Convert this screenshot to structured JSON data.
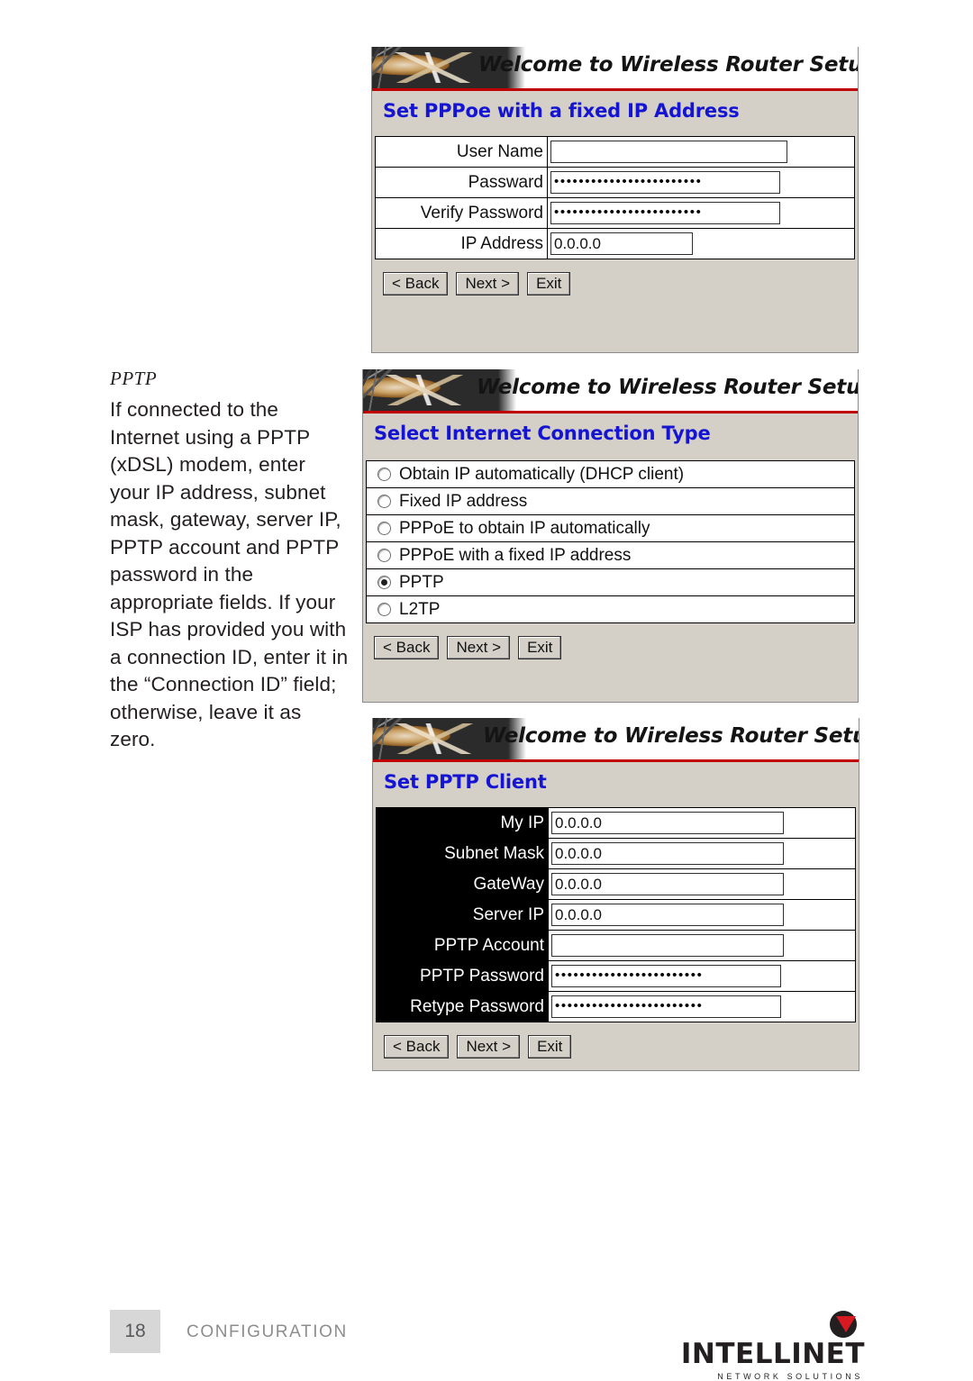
{
  "section": {
    "title": "PPTP",
    "paragraph": "If connected to the Internet using a PPTP (xDSL) modem, enter your IP address, subnet mask, gateway, server IP, PPTP account and PPTP password in the appropriate fields. If your ISP has provided you with a connection ID, enter it in the “Connection ID” field; otherwise, leave it as zero."
  },
  "screens": [
    {
      "banner": "Welcome to Wireless Router Setup Wizard",
      "subhead": "Set PPPoe with a fixed IP Address",
      "fields": [
        {
          "label": "User Name",
          "value": "",
          "type": "text"
        },
        {
          "label": "Passward",
          "value": "••••••••••••••••••••••••",
          "type": "password"
        },
        {
          "label": "Verify Password",
          "value": "••••••••••••••••••••••••",
          "type": "password"
        },
        {
          "label": "IP Address",
          "value": "0.0.0.0",
          "type": "ip"
        }
      ],
      "buttons": [
        "< Back",
        "Next >",
        "Exit"
      ]
    },
    {
      "banner": "Welcome to Wireless Router Setup Wizard",
      "subhead": "Select Internet Connection Type",
      "options": [
        {
          "label": "Obtain IP automatically (DHCP client)",
          "selected": false
        },
        {
          "label": "Fixed IP address",
          "selected": false
        },
        {
          "label": "PPPoE to obtain IP automatically",
          "selected": false
        },
        {
          "label": "PPPoE with a fixed IP address",
          "selected": false
        },
        {
          "label": "PPTP",
          "selected": true
        },
        {
          "label": "L2TP",
          "selected": false
        }
      ],
      "buttons": [
        "< Back",
        "Next >",
        "Exit"
      ]
    },
    {
      "banner": "Welcome to Wireless Router Setup Wizard",
      "subhead": "Set PPTP Client",
      "fields": [
        {
          "label": "My IP",
          "value": "0.0.0.0",
          "type": "ip"
        },
        {
          "label": "Subnet Mask",
          "value": "0.0.0.0",
          "type": "ip"
        },
        {
          "label": "GateWay",
          "value": "0.0.0.0",
          "type": "ip"
        },
        {
          "label": "Server IP",
          "value": "0.0.0.0",
          "type": "ip"
        },
        {
          "label": "PPTP Account",
          "value": "",
          "type": "text"
        },
        {
          "label": "PPTP Password",
          "value": "••••••••••••••••••••••••",
          "type": "password"
        },
        {
          "label": "Retype Password",
          "value": "••••••••••••••••••••••••",
          "type": "password"
        }
      ],
      "buttons": [
        "< Back",
        "Next >",
        "Exit"
      ]
    }
  ],
  "footer": {
    "page_number": "18",
    "label": "CONFIGURATION",
    "brand": "INTELLINET",
    "tagline": "NETWORK SOLUTIONS"
  }
}
